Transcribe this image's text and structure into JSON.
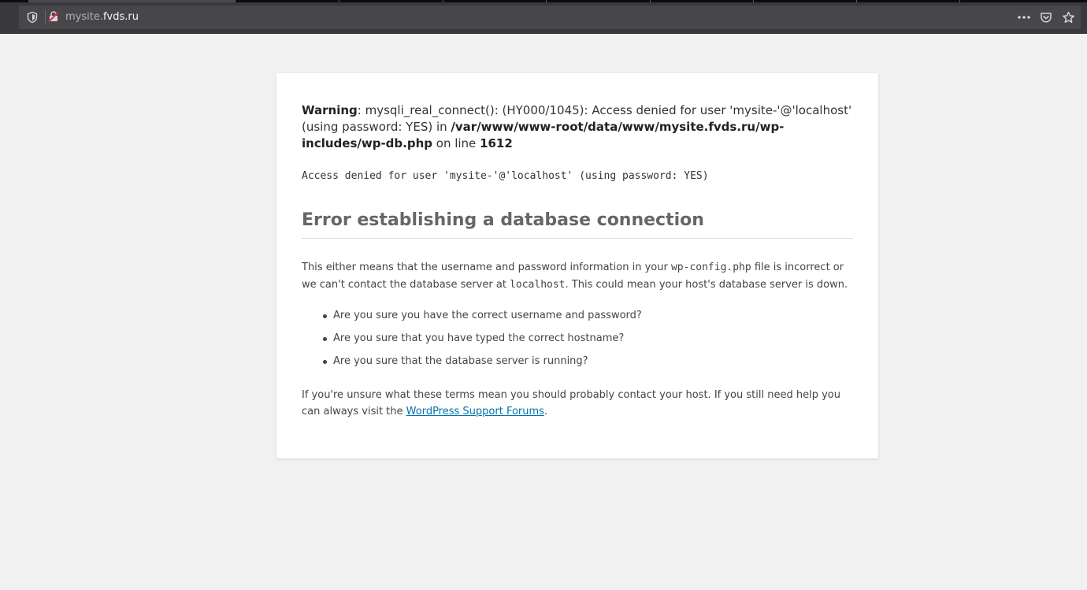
{
  "browser": {
    "url_prefix": "mysite.",
    "url_domain": "fvds.ru",
    "icons": {
      "tracking": "shield-icon",
      "site": "broken-lock-icon",
      "menu": "more-dots-icon",
      "pocket": "pocket-icon",
      "bookmark": "star-icon"
    }
  },
  "warning": {
    "label": "Warning",
    "text1": ": mysqli_real_connect(): (HY000/1045): Access denied for user 'mysite-'@'localhost' (using password: YES) in ",
    "path": "/var/www/www-root/data/www/mysite.fvds.ru/wp-includes/wp-db.php",
    "text2": " on line ",
    "line": "1612"
  },
  "mono_message": "Access denied for user 'mysite-'@'localhost' (using password: YES)",
  "error": {
    "title": "Error establishing a database connection",
    "explain_1": "This either means that the username and password information in your ",
    "config_file": "wp-config.php",
    "explain_2": " file is incorrect or we can't contact the database server at ",
    "host": "localhost",
    "explain_3": ". This could mean your host's database server is down.",
    "checks": [
      "Are you sure you have the correct username and password?",
      "Are you sure that you have typed the correct hostname?",
      "Are you sure that the database server is running?"
    ],
    "help_1": "If you're unsure what these terms mean you should probably contact your host. If you still need help you can always visit the ",
    "help_link": "WordPress Support Forums",
    "help_2": "."
  },
  "colors": {
    "chrome": "#38383d",
    "url_bar": "#474749",
    "page_bg": "#f1f1f1",
    "link": "#0073aa",
    "site_icon": "#e22850"
  }
}
